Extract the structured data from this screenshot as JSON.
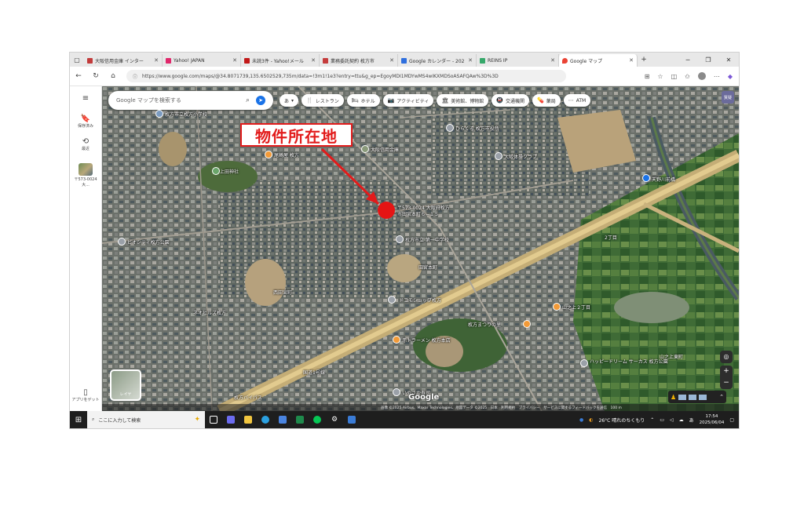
{
  "browser": {
    "tabs": [
      {
        "label": "大阪信用金庫 インター",
        "color": "#c23b3b"
      },
      {
        "label": "Yahoo! JAPAN",
        "color": "#e0286b"
      },
      {
        "label": "未読3件 - Yahoo!メール",
        "color": "#c21818"
      },
      {
        "label": "業務委託契約 枚方市",
        "color": "#c53c3c"
      },
      {
        "label": "Google カレンダー - 202",
        "color": "#2f6fde"
      },
      {
        "label": "REINS IP",
        "color": "#36a86a"
      },
      {
        "label": "Google マップ",
        "color": "#ea4335",
        "active": true
      }
    ],
    "new_tab": "+",
    "url": "https://www.google.com/maps/@34.8071739,135.6502529,735m/data=!3m1!1e3?entry=ttu&g_ep=EgoyMDI1MDYwMS4wIKXMDSoASAFQAw%3D%3D"
  },
  "sidebar": {
    "saved": "保存済み",
    "recent": "最近",
    "thumb_label": "〒573-0024 大...",
    "app_get": "アプリをゲット"
  },
  "map": {
    "search_placeholder": "Google マップを検索する",
    "input_mode": "あ",
    "chips": [
      {
        "icon": "🍴",
        "label": "レストラン"
      },
      {
        "icon": "🛏",
        "label": "ホテル"
      },
      {
        "icon": "📷",
        "label": "アクティビティ"
      },
      {
        "icon": "🏛",
        "label": "美術館、博物館"
      },
      {
        "icon": "🚇",
        "label": "交通機関"
      },
      {
        "icon": "💊",
        "label": "薬局"
      },
      {
        "icon": "⋯",
        "label": "ATM"
      }
    ],
    "grid_label": "質疑",
    "callout": "物件所在地",
    "target_label_1": "〒573-0024 大阪府枚方",
    "target_label_2": "市田宮本町６−１５",
    "labels": {
      "school1": "枚方市立枚方小学校",
      "bank": "大阪信用金庫",
      "bon": "ひらくる 枚方市役所",
      "tenno": "天野川前橋",
      "sushi": "尾崎屋 枚方",
      "tamiya": "田宮本町",
      "junior": "枚方市立 第一中学校",
      "nishitamiya": "西田宮町",
      "park": "上田神社",
      "osaka": "大阪体操クラブ",
      "yamanoue": "山之上東町",
      "dream": "ハッピードリーム サーカス 枚方公園",
      "akaji": "赤トラーメン 枚方本店",
      "chome": "2丁目",
      "yamanoue2": "山之上２丁目",
      "gallery": "ビオシティ枚方公園",
      "pharmacy": "枚方まつりの里",
      "hotel": "ネオヒルズ枚方",
      "store": "ドコモショップ枚方",
      "circle": "いやさか寿司",
      "highway": "枚方バイパス",
      "road1": "国道1号線"
    },
    "layer_label": "レイヤ",
    "attribution": "画像 ©2025 Airbus、Maxar Technologies、地図データ ©2025　日本　利用規約　プライバシー　サービスに関するフィードバックを送信　100 m",
    "google": "Google"
  },
  "taskbar": {
    "search_placeholder": "ここに入力して検索",
    "weather": "26°C 晴れのちくもり",
    "ime": "あ",
    "time": "17:54",
    "date": "2025/06/04"
  },
  "colors": {
    "callout_red": "#e21b1b",
    "pin_red": "#e51414"
  }
}
